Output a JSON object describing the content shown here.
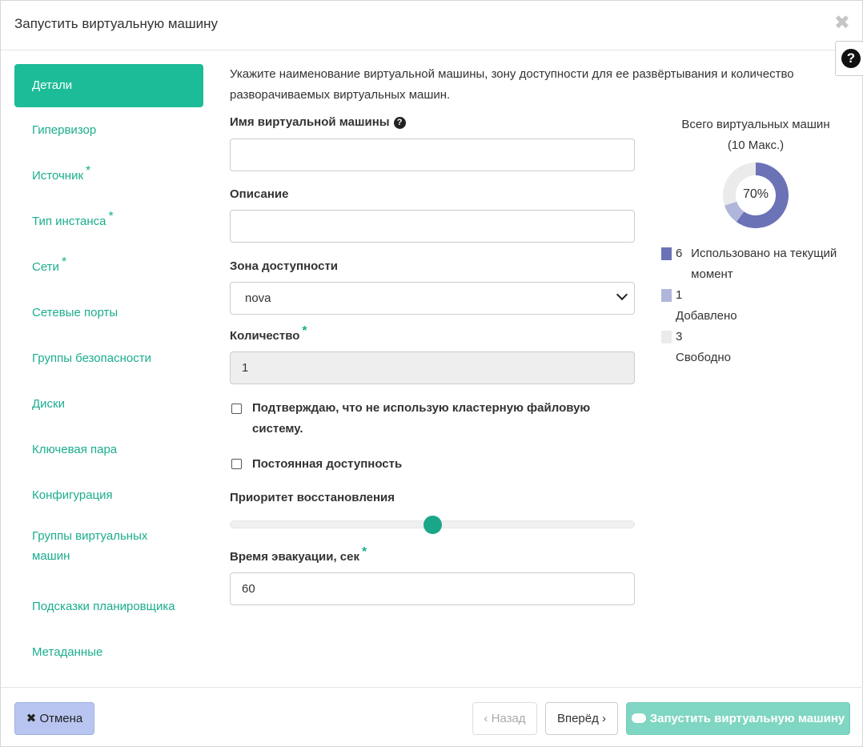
{
  "window": {
    "title": "Запустить виртуальную машину",
    "close_glyph": "✖",
    "help_glyph": "?"
  },
  "sidebar": {
    "items": [
      {
        "label": "Детали",
        "required": false,
        "active": true
      },
      {
        "label": "Гипервизор",
        "required": false
      },
      {
        "label": "Источник",
        "required": true
      },
      {
        "label": "Тип инстанса",
        "required": true
      },
      {
        "label": "Сети",
        "required": true
      },
      {
        "label": "Сетевые порты",
        "required": false
      },
      {
        "label": "Группы безопасности",
        "required": false
      },
      {
        "label": "Диски",
        "required": false
      },
      {
        "label": "Ключевая пара",
        "required": false
      },
      {
        "label": "Конфигурация",
        "required": false
      },
      {
        "label": "Группы виртуальных машин",
        "required": false
      },
      {
        "label": "Подсказки планировщика",
        "required": false
      },
      {
        "label": "Метаданные",
        "required": false
      }
    ],
    "required_mark": "*"
  },
  "form": {
    "intro": "Укажите наименование виртуальной машины, зону доступности для ее развёртывания и количество разворачиваемых виртуальных машин.",
    "name_label": "Имя виртуальной машины",
    "name_value": "",
    "description_label": "Описание",
    "description_value": "",
    "zone_label": "Зона доступности",
    "zone_value": "nova",
    "count_label": "Количество",
    "count_value": "1",
    "cluster_fs_checkbox": "Подтверждаю, что не использую кластерную файловую систему.",
    "cluster_fs_checked": false,
    "ha_checkbox": "Постоянная доступность",
    "ha_checked": false,
    "priority_label": "Приоритет восстановления",
    "priority_level_fraction": 0.5,
    "evacuation_label": "Время эвакуации, сек",
    "evacuation_value": "60"
  },
  "quota": {
    "title_line1": "Всего виртуальных машин",
    "title_line2": "(10 Макс.)",
    "percent_label": "70%",
    "max": 10,
    "legend": [
      {
        "count": "6",
        "label": "Использовано на текущий момент",
        "value": 6,
        "color": "#6b72b6"
      },
      {
        "count": "1",
        "label": "Добавлено",
        "value": 1,
        "color": "#b0b6d9"
      },
      {
        "count": "3",
        "label": "Свободно",
        "value": 3,
        "color": "#ebebeb"
      }
    ]
  },
  "footer": {
    "cancel_label": "Отмена",
    "cancel_glyph": "✖",
    "back_label": "‹ Назад",
    "next_label": "Вперёд ›",
    "launch_label": "Запустить виртуальную машину"
  },
  "colors": {
    "accent": "#1dbc98",
    "link": "#1bad8e",
    "cancel_bg": "#b7c5f0",
    "launch_bg": "#7fd6c2"
  }
}
